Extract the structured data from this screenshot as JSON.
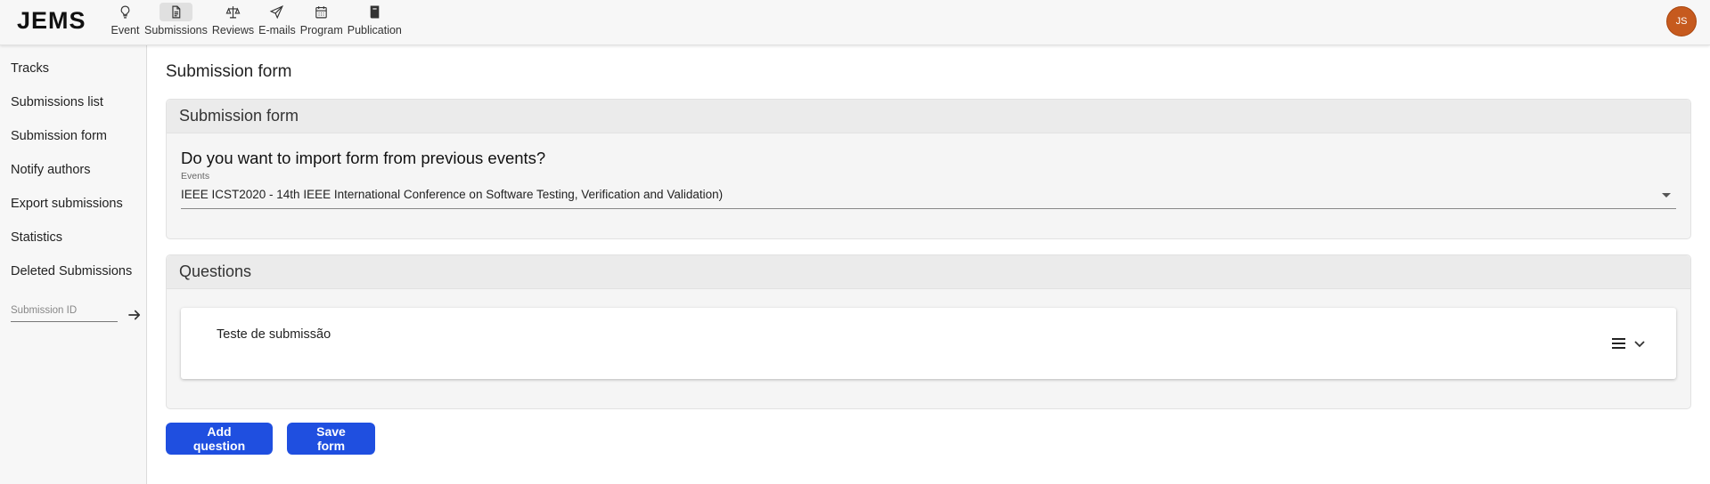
{
  "app": {
    "logo": "JEMS"
  },
  "nav": {
    "items": [
      {
        "label": "Event",
        "icon": "lightbulb-icon"
      },
      {
        "label": "Submissions",
        "icon": "document-icon",
        "active": true
      },
      {
        "label": "Reviews",
        "icon": "scales-icon"
      },
      {
        "label": "E-mails",
        "icon": "paper-plane-icon"
      },
      {
        "label": "Program",
        "icon": "calendar-icon"
      },
      {
        "label": "Publication",
        "icon": "book-icon"
      }
    ]
  },
  "user": {
    "initials": "JS",
    "avatar_color": "#c65a1e"
  },
  "sidebar": {
    "items": [
      {
        "label": "Tracks"
      },
      {
        "label": "Submissions list"
      },
      {
        "label": "Submission form"
      },
      {
        "label": "Notify authors"
      },
      {
        "label": "Export submissions"
      },
      {
        "label": "Statistics"
      },
      {
        "label": "Deleted Submissions"
      }
    ],
    "submission_id_placeholder": "Submission ID"
  },
  "main": {
    "page_title": "Submission form",
    "form_card": {
      "header": "Submission form",
      "import_question": "Do you want to import form from previous events?",
      "events_label": "Events",
      "events_value": "IEEE ICST2020 - 14th IEEE International Conference on Software Testing, Verification and Validation)"
    },
    "questions_card": {
      "header": "Questions",
      "items": [
        {
          "text": "Teste de submissão"
        }
      ]
    },
    "buttons": {
      "add_question": "Add question",
      "save_form": "Save form"
    }
  },
  "colors": {
    "primary_button": "#1f4fe0",
    "sidebar_bg": "#f7f7f7"
  }
}
